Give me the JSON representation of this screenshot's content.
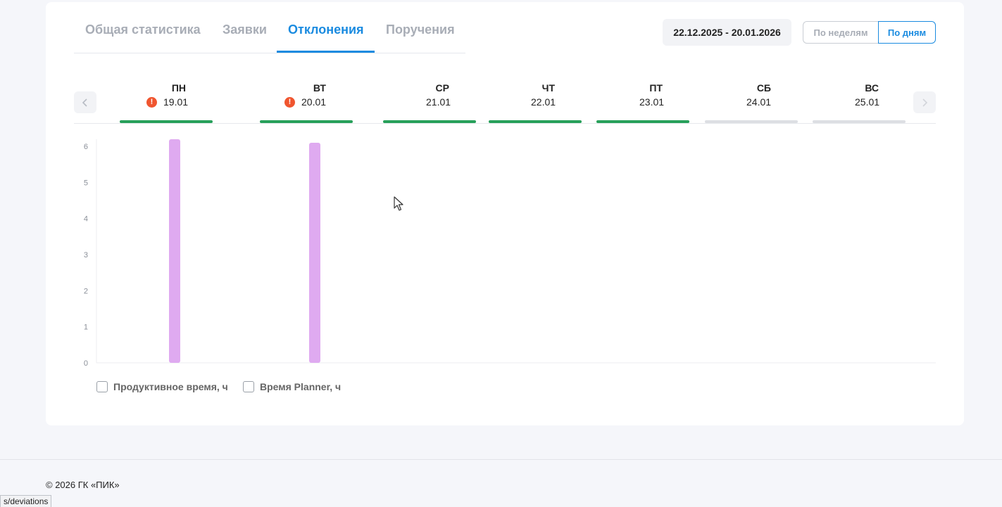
{
  "tabs": [
    {
      "label": "Общая статистика",
      "active": false
    },
    {
      "label": "Заявки",
      "active": false
    },
    {
      "label": "Отклонения",
      "active": true
    },
    {
      "label": "Поручения",
      "active": false
    }
  ],
  "date_range": "22.12.2025 - 20.01.2026",
  "view_toggle": {
    "weeks_label": "По неделям",
    "days_label": "По дням",
    "selected": "days"
  },
  "nav": {
    "prev_icon": "chevron-left-icon",
    "next_icon": "chevron-right-icon"
  },
  "days": [
    {
      "name": "ПН",
      "date": "19.01",
      "warning": true,
      "status_color": "#27a05a"
    },
    {
      "name": "ВТ",
      "date": "20.01",
      "warning": true,
      "status_color": "#27a05a"
    },
    {
      "name": "СР",
      "date": "21.01",
      "warning": false,
      "status_color": "#27a05a"
    },
    {
      "name": "ЧТ",
      "date": "22.01",
      "warning": false,
      "status_color": "#27a05a"
    },
    {
      "name": "ПТ",
      "date": "23.01",
      "warning": false,
      "status_color": "#27a05a"
    },
    {
      "name": "СБ",
      "date": "24.01",
      "warning": false,
      "status_color": "#dddfe3"
    },
    {
      "name": "ВС",
      "date": "25.01",
      "warning": false,
      "status_color": "#dddfe3"
    }
  ],
  "chart_data": {
    "type": "bar",
    "categories": [
      "ПН",
      "ВТ",
      "СР",
      "ЧТ",
      "ПТ",
      "СБ",
      "ВС"
    ],
    "values": [
      6.3,
      6.2,
      0,
      0,
      0,
      0,
      0
    ],
    "yticks": [
      "0",
      "1",
      "2",
      "3",
      "4",
      "5",
      "6"
    ],
    "ylim": [
      0,
      6.3
    ],
    "bar_color": "#dfaaf0",
    "legend": [
      "Продуктивное время, ч",
      "Время Planner, ч"
    ],
    "legend_placement": "bottom-left"
  },
  "footer": {
    "copyright": "© 2026 ГК «ПИК»"
  },
  "status_bar": {
    "url_fragment": "s/deviations"
  }
}
